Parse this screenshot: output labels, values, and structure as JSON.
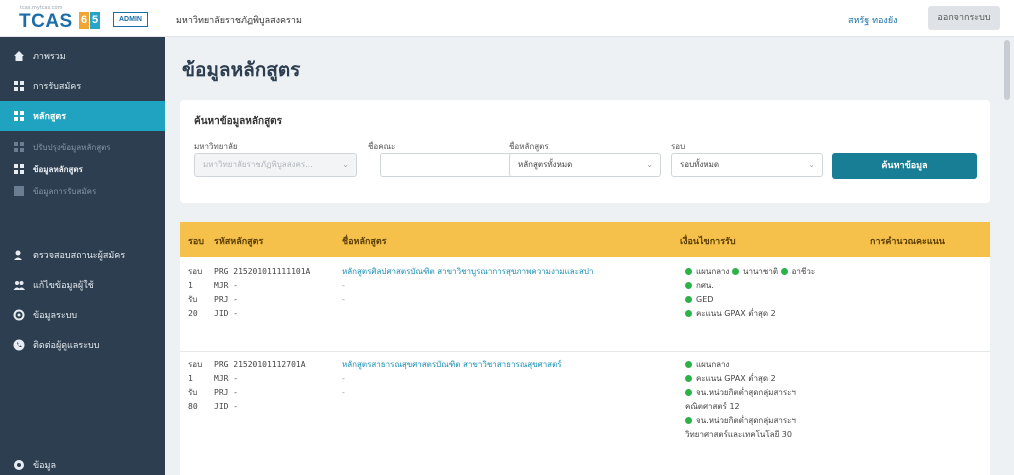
{
  "header": {
    "logo_small": "tcas.mytcas.com",
    "logo_text": "TCAS",
    "logo_digits": [
      "6",
      "5"
    ],
    "badge": "ADMIN",
    "university": "มหาวิทยาลัยราชภัฏพิบูลสงคราม",
    "user_name": "สหรัฐ ทองยัง",
    "logout_label": "ออกจากระบบ"
  },
  "sidebar": {
    "items": [
      {
        "label": "ภาพรวม",
        "icon": "home-icon"
      },
      {
        "label": "การรับสมัคร",
        "icon": "grid-icon"
      },
      {
        "label": "หลักสูตร",
        "icon": "grid-icon"
      },
      {
        "label": "ปรับปรุงข้อมูลหลักสูตร",
        "icon": "grid-icon"
      },
      {
        "label": "ข้อมูลหลักสูตร",
        "icon": "grid-icon"
      },
      {
        "label": "ข้อมูลการรับสมัคร",
        "icon": "grid-icon"
      },
      {
        "label": "ตรวจสอบสถานะผู้สมัคร",
        "icon": "user-check-icon"
      },
      {
        "label": "แก้ไขข้อมูลผู้ใช้",
        "icon": "users-icon"
      },
      {
        "label": "ข้อมูลระบบ",
        "icon": "gear-icon"
      },
      {
        "label": "ติดต่อผู้ดูแลระบบ",
        "icon": "phone-icon"
      },
      {
        "label": "ข้อมูล",
        "icon": "info-icon"
      }
    ]
  },
  "page": {
    "title": "ข้อมูลหลักสูตร"
  },
  "search": {
    "heading": "ค้นหาข้อมูลหลักสูตร",
    "university_label": "มหาวิทยาลัย",
    "university_value": "มหาวิทยาลัยราชภัฏพิบูลสงคร...",
    "faculty_label": "ชื่อคณะ",
    "faculty_value": "",
    "course_label": "ชื่อหลักสูตร",
    "course_value": "หลักสูตรทั้งหมด",
    "round_label": "รอบ",
    "round_value": "รอบทั้งหมด",
    "button_label": "ค้นหาข้อมูล"
  },
  "table": {
    "headers": {
      "round": "รอบ",
      "code": "รหัสหลักสูตร",
      "name": "ชื่อหลักสูตร",
      "conditions": "เงื่อนไขการรับ",
      "calc": "การคำนวณคะแนน"
    },
    "rows": [
      {
        "round_word": "รอบ",
        "round_num": "1",
        "seats_word": "รับ",
        "seats_num": "20",
        "prg": "PRG 215201011111101A",
        "mjr": "MJR -",
        "prj": "PRJ -",
        "jid": "JID -",
        "course": "หลักสูตรศิลปศาสตรบัณฑิต สาขาวิชาบูรณาการสุขภาพความงามและสปา",
        "course_sub": "-",
        "course_sub2": "-",
        "conditions": [
          "● แผนกลาง ● นานาชาติ ● อาชีวะ",
          "● กศน.",
          "● GED",
          "● คะแนน GPAX ต่ำสุด 2"
        ]
      },
      {
        "round_word": "รอบ",
        "round_num": "1",
        "seats_word": "รับ",
        "seats_num": "80",
        "prg": "PRG 21520101112701A",
        "mjr": "MJR -",
        "prj": "PRJ -",
        "jid": "JID -",
        "course": "หลักสูตรสาธารณสุขศาสตรบัณฑิต สาขาวิชาสาธารณสุขศาสตร์",
        "course_sub": "-",
        "course_sub2": "-",
        "conditions": [
          "● แผนกลาง",
          "● คะแนน GPAX ต่ำสุด 2",
          "● จน.หน่วยกิตต่ำสุดกลุ่มสาระฯ",
          "คณิตศาสตร์ 12",
          "● จน.หน่วยกิตต่ำสุดกลุ่มสาระฯ",
          "วิทยาศาสตร์และเทคโนโลยี 30"
        ]
      }
    ]
  }
}
